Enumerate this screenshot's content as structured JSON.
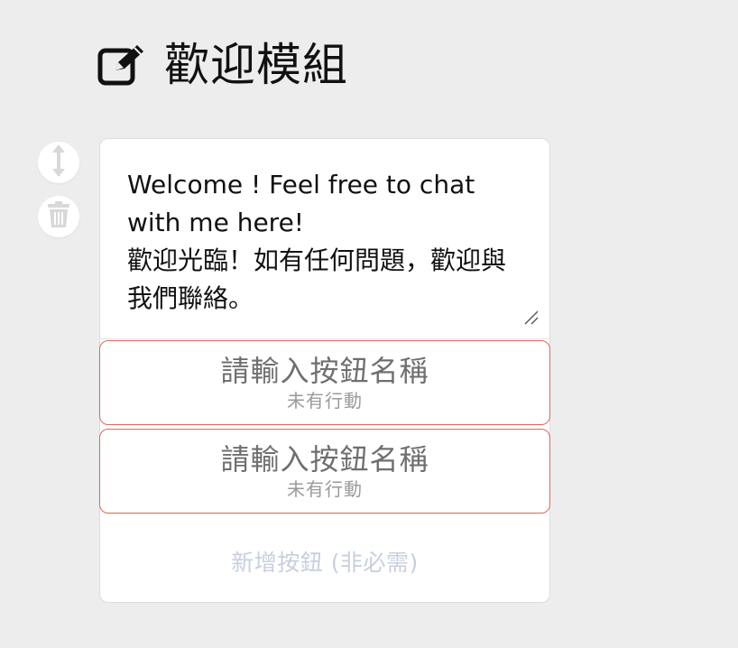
{
  "header": {
    "title": "歡迎模組",
    "icon": "edit-icon"
  },
  "side_controls": {
    "move_icon": "vertical-arrows-icon",
    "delete_icon": "trash-icon"
  },
  "card": {
    "message": "Welcome ! Feel free to chat with me here!\n歡迎光臨！如有任何問題，歡迎與我們聯絡。",
    "buttons": [
      {
        "name_placeholder": "請輸入按鈕名稱",
        "action": "未有行動"
      },
      {
        "name_placeholder": "請輸入按鈕名稱",
        "action": "未有行動"
      }
    ],
    "add_button_label": "新增按鈕 (非必需)"
  },
  "colors": {
    "background": "#ededed",
    "card": "#ffffff",
    "button_border": "#d9695a",
    "add_button_text": "#c7cfde",
    "placeholder_text": "#6f6f6f"
  }
}
